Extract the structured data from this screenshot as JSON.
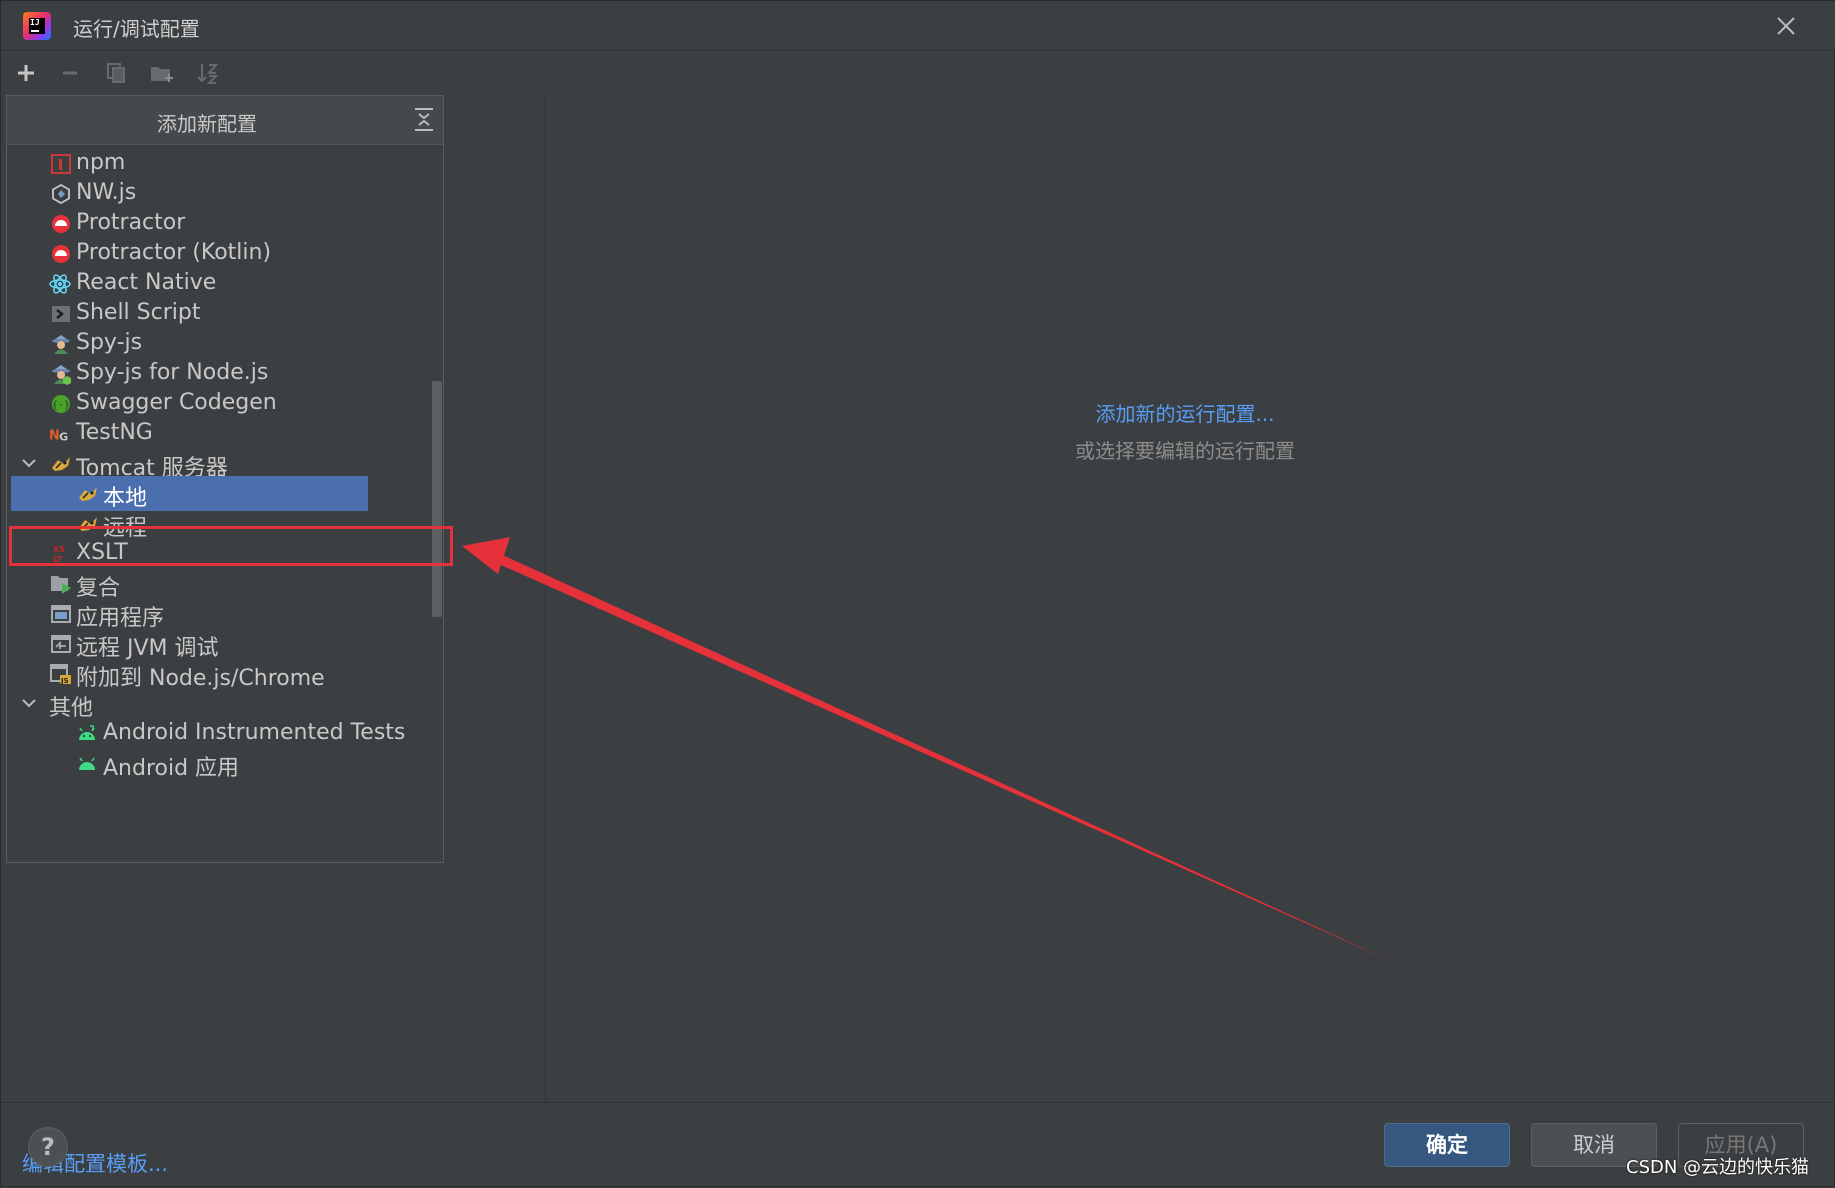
{
  "window": {
    "title": "运行/调试配置"
  },
  "popup": {
    "title": "添加新配置"
  },
  "tree": [
    {
      "label": "npm",
      "icon": "npm-icon",
      "level": 1
    },
    {
      "label": "NW.js",
      "icon": "nwjs-icon",
      "level": 1
    },
    {
      "label": "Protractor",
      "icon": "protractor-icon",
      "level": 1
    },
    {
      "label": "Protractor (Kotlin)",
      "icon": "protractor-icon",
      "level": 1
    },
    {
      "label": "React Native",
      "icon": "react-icon",
      "level": 1
    },
    {
      "label": "Shell Script",
      "icon": "shell-script-icon",
      "level": 1
    },
    {
      "label": "Spy-js",
      "icon": "spy-js-icon",
      "level": 1
    },
    {
      "label": "Spy-js for Node.js",
      "icon": "spy-js-node-icon",
      "level": 1
    },
    {
      "label": "Swagger Codegen",
      "icon": "swagger-icon",
      "level": 1
    },
    {
      "label": "TestNG",
      "icon": "testng-icon",
      "level": 1
    },
    {
      "label": "Tomcat 服务器",
      "icon": "tomcat-icon",
      "level": 1,
      "expanded": true
    },
    {
      "label": "本地",
      "icon": "tomcat-icon",
      "level": 2,
      "selected": true
    },
    {
      "label": "远程",
      "icon": "tomcat-icon",
      "level": 2
    },
    {
      "label": "XSLT",
      "icon": "xslt-icon",
      "level": 1
    },
    {
      "label": "复合",
      "icon": "compound-icon",
      "level": 1
    },
    {
      "label": "应用程序",
      "icon": "application-icon",
      "level": 1
    },
    {
      "label": "远程 JVM 调试",
      "icon": "remote-debug-icon",
      "level": 1
    },
    {
      "label": "附加到 Node.js/Chrome",
      "icon": "attach-node-icon",
      "level": 1
    },
    {
      "label": "其他",
      "icon": "",
      "level": 0,
      "expanded": true
    },
    {
      "label": "Android Instrumented Tests",
      "icon": "android-icon",
      "level": 2
    },
    {
      "label": "Android 应用",
      "icon": "android-icon",
      "level": 2
    }
  ],
  "left_panel": {
    "edit_templates_link": "编辑配置模板..."
  },
  "right_panel": {
    "empty_link": "添加新的运行配置...",
    "empty_hint": "或选择要编辑的运行配置"
  },
  "buttons": {
    "help": "?",
    "ok": "确定",
    "cancel": "取消",
    "apply": "应用(A)"
  },
  "watermark": "CSDN @云边的快乐猫",
  "colors": {
    "selection": "#4b6eaf",
    "link": "#589df6",
    "annotation": "#e5313a"
  }
}
